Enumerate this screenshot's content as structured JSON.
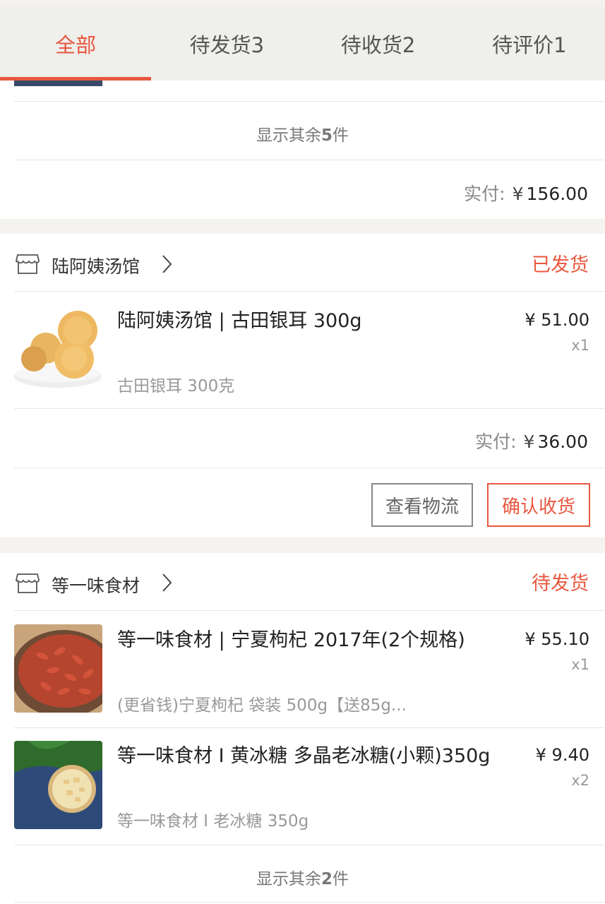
{
  "tabs": [
    {
      "label": "全部"
    },
    {
      "label": "待发货3"
    },
    {
      "label": "待收货2"
    },
    {
      "label": "待评价1"
    }
  ],
  "order_prev": {
    "show_more_prefix": "显示其余",
    "show_more_count": "5",
    "show_more_suffix": "件",
    "paid_label": "实付:",
    "paid_currency": "¥",
    "paid_amount": "156.00"
  },
  "order_shop1": {
    "shop_name": "陆阿姨汤馆",
    "status": "已发货",
    "items": [
      {
        "title": "陆阿姨汤馆 | 古田银耳 300g",
        "spec": "古田银耳 300克",
        "price": "¥ 51.00",
        "qty": "x1",
        "image": "tremella-mushroom"
      }
    ],
    "paid_label": "实付:",
    "paid_currency": "¥",
    "paid_amount": "36.00",
    "buttons": {
      "logistics": "查看物流",
      "confirm": "确认收货"
    }
  },
  "order_shop2": {
    "shop_name": "等一味食材",
    "status": "待发货",
    "items": [
      {
        "title": "等一味食材 | 宁夏枸杞 2017年(2个规格)",
        "spec": "(更省钱)宁夏枸杞 袋装 500g【送85g...",
        "price": "¥ 55.10",
        "qty": "x1",
        "image": "goji-berries"
      },
      {
        "title": "等一味食材 I 黄冰糖 多晶老冰糖(小颗)350g",
        "spec": "等一味食材 I 老冰糖 350g",
        "price": "¥ 9.40",
        "qty": "x2",
        "image": "rock-sugar"
      }
    ],
    "show_more_prefix": "显示其余",
    "show_more_count": "2",
    "show_more_suffix": "件"
  },
  "colors": {
    "accent": "#e8573f",
    "background": "#f4f3ef",
    "tabbar": "#efefeb"
  }
}
